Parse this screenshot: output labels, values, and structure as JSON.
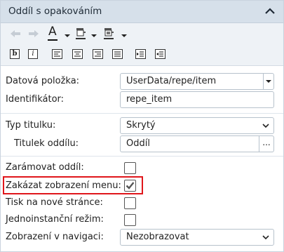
{
  "panel": {
    "title": "Oddíl s opakováním"
  },
  "form": {
    "data_item_label": "Datová položka:",
    "data_item_value": "UserData/repe/item",
    "identifier_label": "Identifikátor:",
    "identifier_value": "repe_item",
    "title_type_label": "Typ titulku:",
    "title_type_value": "Skrytý",
    "section_title_label": "Titulek oddílu:",
    "section_title_value": "Oddíl",
    "section_title_more": "...",
    "frame_section_label": "Zarámovat oddíl:",
    "disable_menu_label": "Zakázat zobrazení menu:",
    "print_new_page_label": "Tisk na nové stránce:",
    "single_instance_label": "Jednoinstanční režim:",
    "nav_display_label": "Zobrazení v navigaci:",
    "nav_display_value": "Nezobrazovat"
  },
  "checkboxes": {
    "frame_section": false,
    "disable_menu": true,
    "print_new_page": false,
    "single_instance": false
  },
  "toolbar": {
    "bold_glyph": "b",
    "italic_glyph": "i",
    "font_color_glyph": "A"
  }
}
